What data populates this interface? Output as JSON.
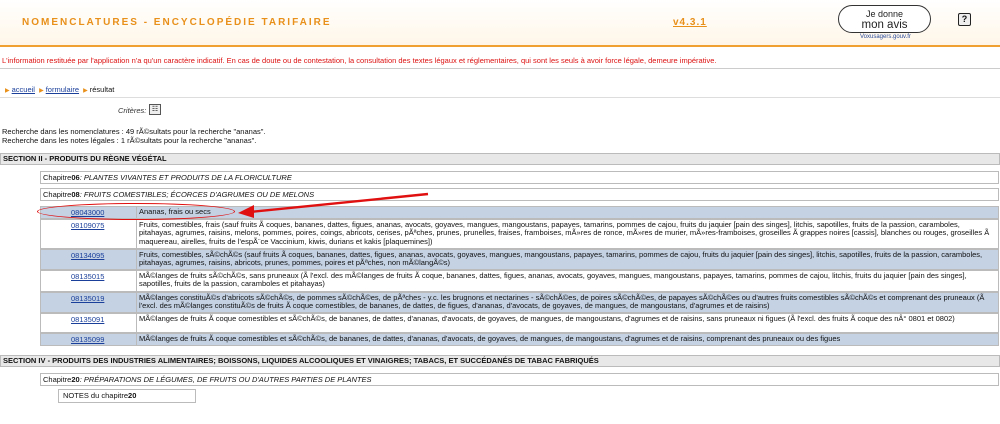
{
  "header": {
    "title": "NOMENCLATURES - ENCYCLOPÉDIE TARIFAIRE",
    "version": "v4.3.1",
    "avis_line1": "Je donne",
    "avis_line2": "mon avis",
    "avis_sub": "Voxusagers.gouv.fr",
    "help": "?"
  },
  "disclaimer": "L'information restituée par l'application n'a qu'un caractère indicatif. En cas de doute ou de contestation, la consultation des textes légaux et réglementaires, qui sont les seuls à avoir force légale, demeure impérative.",
  "breadcrumb": {
    "accueil": "accueil",
    "formulaire": "formulaire",
    "resultat": "résultat"
  },
  "criteres": "Critères",
  "summary": {
    "line1": "Recherche dans les nomenclatures : 49 rÃ©sultats pour la recherche \"ananas\".",
    "line2": "Recherche dans les notes légales : 1 rÃ©sultats pour la recherche \"ananas\"."
  },
  "sections": {
    "s2": "SECTION II - PRODUITS DU RÈGNE VÉGÉTAL",
    "s4": "SECTION IV - PRODUITS DES INDUSTRIES ALIMENTAIRES; BOISSONS, LIQUIDES ALCOOLIQUES ET VINAIGRES; TABACS, ET SUCCÉDANÉS DE TABAC FABRIQUÉS"
  },
  "chapters": {
    "c06_label": "Chapitre",
    "c06_num": "06",
    "c06_title": ": PLANTES VIVANTES ET PRODUITS DE LA FLORICULTURE",
    "c08_label": "Chapitre",
    "c08_num": "08",
    "c08_title": ": FRUITS COMESTIBLES; ÉCORCES D'AGRUMES OU DE MELONS",
    "c20_label": "Chapitre",
    "c20_num": "20",
    "c20_title": ": PRÉPARATIONS DE LÉGUMES, DE FRUITS OU D'AUTRES PARTIES DE PLANTES"
  },
  "rows": [
    {
      "code": "08043000",
      "desc": "Ananas, frais ou secs"
    },
    {
      "code": "08109075",
      "desc": "Fruits, comestibles, frais (sauf fruits Ã  coques, bananes, dattes, figues, ananas, avocats, goyaves, mangues, mangoustans, papayes, tamarins, pommes de cajou, fruits du jaquier [pain des singes], litchis, sapotilles, fruits de la passion, caramboles, pitahayas, agrumes, raisins, melons, pommes, poires, coings, abricots, cerises, pÃªches, prunes, prunelles, fraises, framboises, mÃ»res de ronce, mÃ»res de murier, mÃ»res-framboises, groseilles Ã  grappes noires [cassis], blanches ou rouges, groseilles Ã  maquereau, airelles, fruits de l'espÃ¨ce Vaccinium, kiwis, durians et kakis [plaquemines])"
    },
    {
      "code": "08134095",
      "desc": "Fruits, comestibles, sÃ©chÃ©s (sauf fruits Ã  coques, bananes, dattes, figues, ananas, avocats, goyaves, mangues, mangoustans, papayes, tamarins, pommes de cajou, fruits du jaquier [pain des singes], litchis, sapotilles, fruits de la passion, caramboles, pitahayas, agrumes, raisins, abricots, prunes, pommes, poires et pÃªches, non mÃ©langÃ©s)"
    },
    {
      "code": "08135015",
      "desc": "MÃ©langes de fruits sÃ©chÃ©s, sans pruneaux (Ã  l'excl. des mÃ©langes de fruits Ã  coque, bananes, dattes, figues, ananas, avocats, goyaves, mangues, mangoustans, papayes, tamarins, pommes de cajou, litchis, fruits du jaquier [pain des singes], sapotilles, fruits de la passion, caramboles et pitahayas)"
    },
    {
      "code": "08135019",
      "desc": "MÃ©langes constituÃ©s d'abricots sÃ©chÃ©s, de pommes sÃ©chÃ©es, de pÃªches - y.c. les brugnons et nectarines - sÃ©chÃ©es, de poires sÃ©chÃ©es, de papayes sÃ©chÃ©es ou d'autres fruits comestibles sÃ©chÃ©s et comprenant des pruneaux (Ã  l'excl. des mÃ©langes constituÃ©s de fruits Ã  coque comestibles, de bananes, de dattes, de figues, d'ananas, d'avocats, de goyaves, de mangues, de mangoustans, d'agrumes et de raisins)"
    },
    {
      "code": "08135091",
      "desc": "MÃ©langes de fruits Ã  coque comestibles et sÃ©chÃ©s, de bananes, de dattes, d'ananas, d'avocats, de goyaves, de mangues, de mangoustans, d'agrumes et de raisins, sans pruneaux ni figues (Ã  l'excl. des fruits Ã  coque des nÂ° 0801 et 0802)"
    },
    {
      "code": "08135099",
      "desc": "MÃ©langes de fruits Ã  coque comestibles et sÃ©chÃ©s, de bananes, de dattes, d'ananas, d'avocats, de goyaves, de mangues, de mangoustans, d'agrumes et de raisins, comprenant des pruneaux ou des figues"
    }
  ],
  "notes": {
    "label": "NOTES du chapitre",
    "num": "20"
  },
  "colors": {
    "accent": "#e8901a",
    "link": "#1a3f9a",
    "row_blue": "#c4d2e4",
    "highlight": "#e01010"
  }
}
